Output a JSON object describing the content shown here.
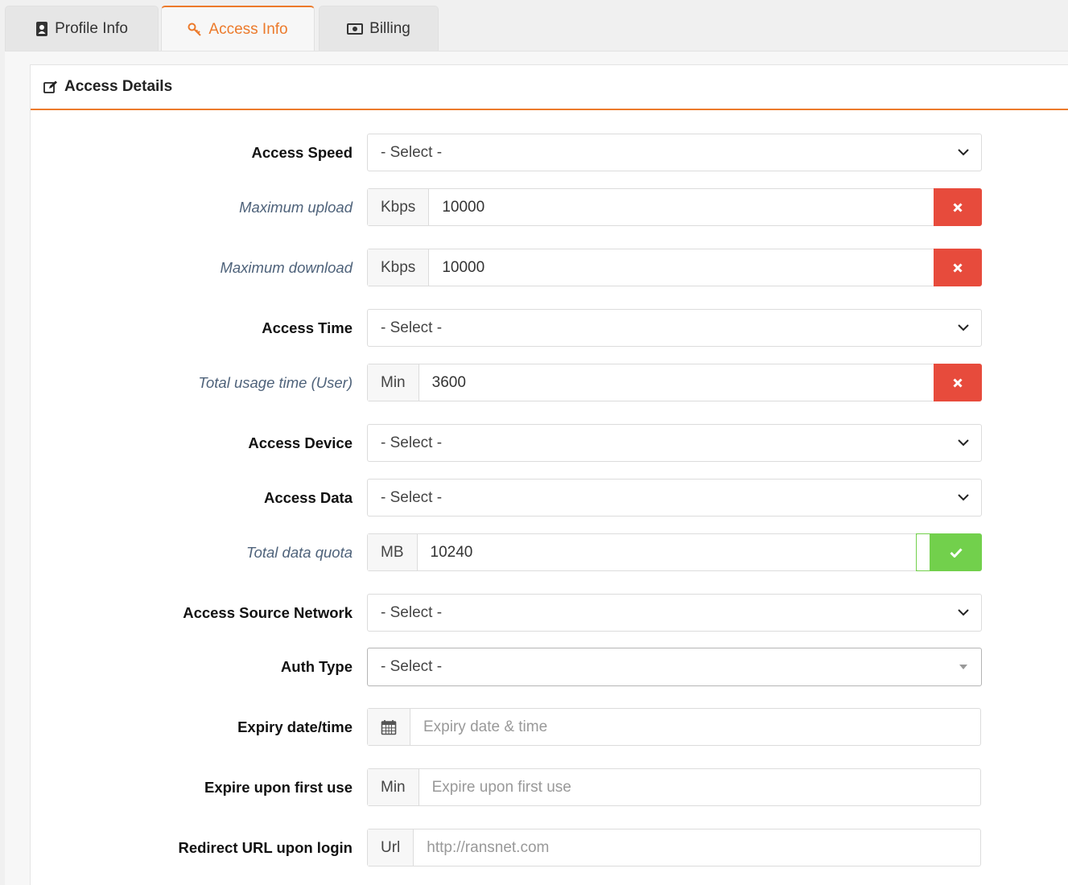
{
  "tabs": [
    {
      "label": "Profile Info",
      "icon": "contact-book-icon",
      "active": false
    },
    {
      "label": "Access Info",
      "icon": "key-icon",
      "active": true
    },
    {
      "label": "Billing",
      "icon": "money-icon",
      "active": false
    }
  ],
  "card": {
    "title": "Access Details",
    "icon": "edit-icon"
  },
  "colors": {
    "accent": "#ec7a2b",
    "danger": "#e74b3c",
    "success": "#72d04c"
  },
  "fields": {
    "access_speed": {
      "label": "Access Speed",
      "value": "- Select -"
    },
    "max_upload": {
      "label": "Maximum upload",
      "unit": "Kbps",
      "value": "10000"
    },
    "max_download": {
      "label": "Maximum download",
      "unit": "Kbps",
      "value": "10000"
    },
    "access_time": {
      "label": "Access Time",
      "value": "- Select -"
    },
    "total_usage_time": {
      "label": "Total usage time (User)",
      "unit": "Min",
      "value": "3600"
    },
    "access_device": {
      "label": "Access Device",
      "value": "- Select -"
    },
    "access_data": {
      "label": "Access Data",
      "value": "- Select -"
    },
    "total_data_quota": {
      "label": "Total data quota",
      "unit": "MB",
      "value": "10240"
    },
    "access_source_network": {
      "label": "Access Source Network",
      "value": "- Select -"
    },
    "auth_type": {
      "label": "Auth Type",
      "value": "- Select -"
    },
    "expiry": {
      "label": "Expiry date/time",
      "placeholder": "Expiry date & time",
      "icon": "calendar-icon"
    },
    "expire_first_use": {
      "label": "Expire upon first use",
      "unit": "Min",
      "placeholder": "Expire upon first use"
    },
    "redirect_url": {
      "label": "Redirect URL upon login",
      "unit": "Url",
      "placeholder": "http://ransnet.com"
    }
  }
}
